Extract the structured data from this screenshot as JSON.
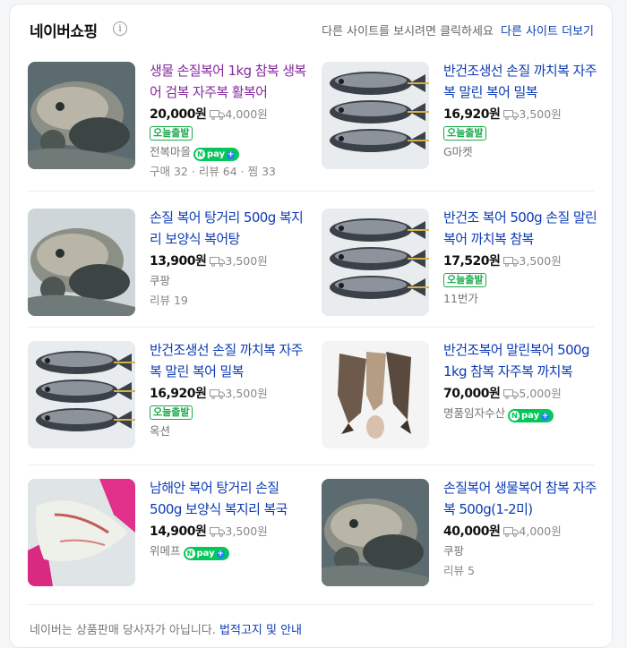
{
  "header": {
    "title": "네이버쇼핑",
    "info_icon": "info-icon",
    "prompt": "다른 사이트를 보시려면 클릭하세요",
    "more_link": "다른 사이트 더보기"
  },
  "colors": {
    "link": "#0d3cb5",
    "visited": "#862a9e",
    "badge_green": "#19ab4a",
    "npay_green": "#03c75a"
  },
  "products": [
    {
      "title": "생물 손질복어 1kg 참복 생복어 검복 자주복 활복어",
      "visited": true,
      "price": "20,000원",
      "shipping": "4,000원",
      "badge": "오늘출발",
      "seller": "전복마을",
      "npay": true,
      "meta": [
        "구매 32",
        "리뷰 64",
        "찜 33"
      ],
      "image": "fish-photo"
    },
    {
      "title": "반건조생선 손질 까치복 자주복 말린 복어 밀복",
      "visited": false,
      "price": "16,920원",
      "shipping": "3,500원",
      "badge": "오늘출발",
      "seller": "G마켓",
      "npay": false,
      "meta": [],
      "image": "dried-fish-photo"
    },
    {
      "title": "손질 복어 탕거리 500g 복지리 보양식 복어탕",
      "visited": false,
      "price": "13,900원",
      "shipping": "3,500원",
      "badge": "",
      "seller": "쿠팡",
      "npay": false,
      "meta": [
        "리뷰 19"
      ],
      "image": "fish-photo"
    },
    {
      "title": "반건조 복어 500g 손질 말린 복어 까치복 참복",
      "visited": false,
      "price": "17,520원",
      "shipping": "3,500원",
      "badge": "오늘출발",
      "seller": "11번가",
      "npay": false,
      "meta": [],
      "image": "dried-fish-photo"
    },
    {
      "title": "반건조생선 손질 까치복 자주복 말린 복어 밀복",
      "visited": false,
      "price": "16,920원",
      "shipping": "3,500원",
      "badge": "오늘출발",
      "seller": "옥션",
      "npay": false,
      "meta": [],
      "image": "dried-fish-photo"
    },
    {
      "title": "반건조복어 말린복어 500g 1kg 참복 자주복 까치복",
      "visited": false,
      "price": "70,000원",
      "shipping": "5,000원",
      "badge": "",
      "seller": "명품임자수산",
      "npay": true,
      "meta": [],
      "image": "dried-fish-photo"
    },
    {
      "title": "남해안 복어 탕거리 손질 500g 보양식 복지리 복국",
      "visited": false,
      "price": "14,900원",
      "shipping": "3,500원",
      "badge": "",
      "seller": "위메프",
      "npay": true,
      "meta": [],
      "image": "fillet-photo"
    },
    {
      "title": "손질복어 생물복어 참복 자주복 500g(1-2미)",
      "visited": false,
      "price": "40,000원",
      "shipping": "4,000원",
      "badge": "",
      "seller": "쿠팡",
      "npay": false,
      "meta": [
        "리뷰 5"
      ],
      "image": "fish-photo"
    }
  ],
  "npay_label": "pay",
  "npay_n": "N",
  "footer": {
    "notice": "네이버는 상품판매 당사자가 아닙니다.",
    "link": "법적고지 및 안내"
  }
}
